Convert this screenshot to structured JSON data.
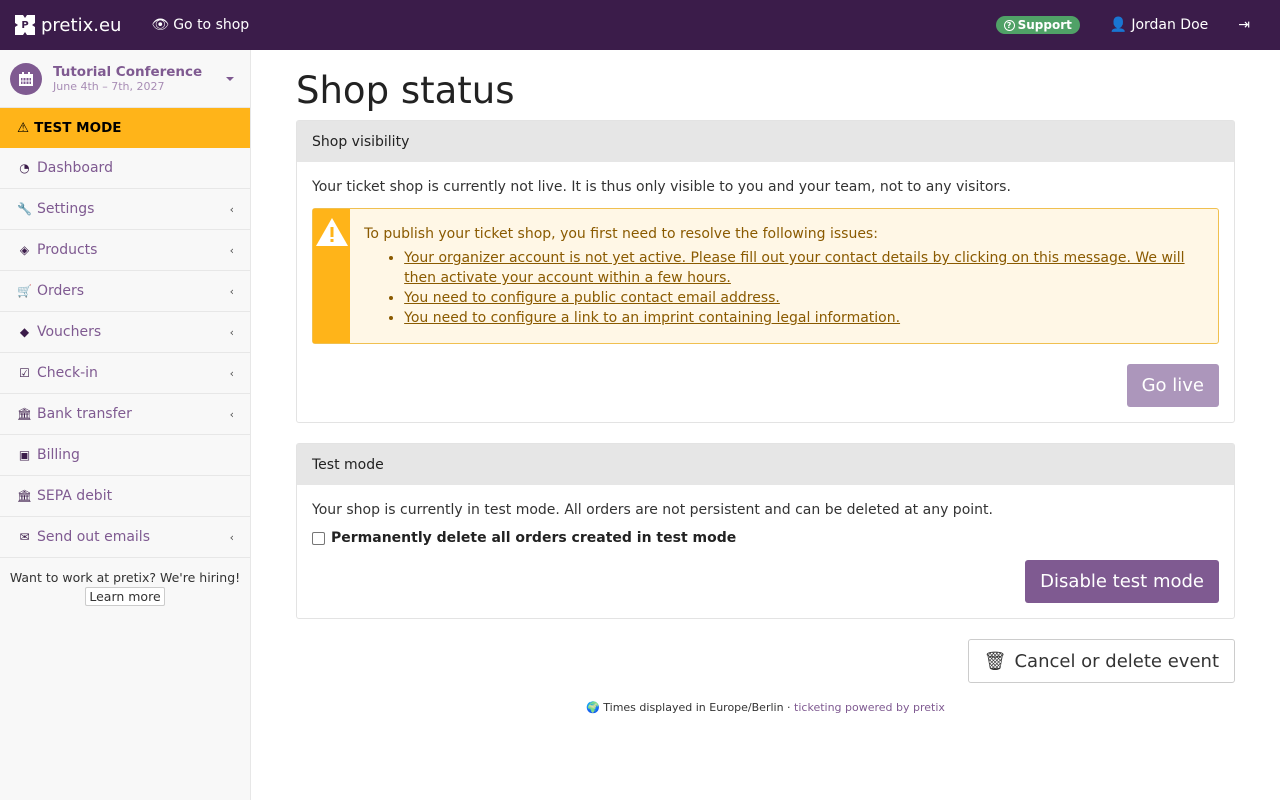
{
  "topbar": {
    "brand": "pretix.eu",
    "goto_shop": "Go to shop",
    "support": "Support",
    "user": "Jordan Doe"
  },
  "sidebar": {
    "event_title": "Tutorial Conference",
    "event_date": "June 4th – 7th, 2027",
    "test_mode": "TEST MODE",
    "items": [
      {
        "label": "Dashboard",
        "icon": "dashboard-icon",
        "glyph": "◔",
        "has_submenu": false
      },
      {
        "label": "Settings",
        "icon": "wrench-icon",
        "glyph": "🔧",
        "has_submenu": true
      },
      {
        "label": "Products",
        "icon": "ticket-icon",
        "glyph": "◈",
        "has_submenu": true
      },
      {
        "label": "Orders",
        "icon": "cart-icon",
        "glyph": "🛒",
        "has_submenu": true
      },
      {
        "label": "Vouchers",
        "icon": "tags-icon",
        "glyph": "◆",
        "has_submenu": true
      },
      {
        "label": "Check-in",
        "icon": "check-square-icon",
        "glyph": "☑",
        "has_submenu": true
      },
      {
        "label": "Bank transfer",
        "icon": "bank-icon",
        "glyph": "🏛",
        "has_submenu": true
      },
      {
        "label": "Billing",
        "icon": "money-icon",
        "glyph": "▣",
        "has_submenu": false
      },
      {
        "label": "SEPA debit",
        "icon": "bank-icon",
        "glyph": "🏛",
        "has_submenu": false
      },
      {
        "label": "Send out emails",
        "icon": "envelope-icon",
        "glyph": "✉",
        "has_submenu": true
      }
    ],
    "hiring_text": "Want to work at pretix? We're hiring!",
    "learn_more": "Learn more"
  },
  "main": {
    "title": "Shop status",
    "visibility_panel": {
      "heading": "Shop visibility",
      "text": "Your ticket shop is currently not live. It is thus only visible to you and your team, not to any visitors.",
      "alert_intro": "To publish your ticket shop, you first need to resolve the following issues:",
      "issues": [
        "Your organizer account is not yet active. Please fill out your contact details by clicking on this message. We will then activate your account within a few hours.",
        "You need to configure a public contact email address.",
        "You need to configure a link to an imprint containing legal information."
      ],
      "go_live": "Go live"
    },
    "testmode_panel": {
      "heading": "Test mode",
      "text": "Your shop is currently in test mode. All orders are not persistent and can be deleted at any point.",
      "checkbox_label": "Permanently delete all orders created in test mode",
      "checkbox_checked": false,
      "disable_button": "Disable test mode"
    },
    "cancel_button": "Cancel or delete event"
  },
  "footer": {
    "timezone": "Times displayed in Europe/Berlin ·",
    "powered_by": "ticketing powered by pretix"
  },
  "colors": {
    "brand": "#3b1c4a",
    "accent": "#7f5a91",
    "warning": "#ffb419",
    "success": "#50a167"
  }
}
